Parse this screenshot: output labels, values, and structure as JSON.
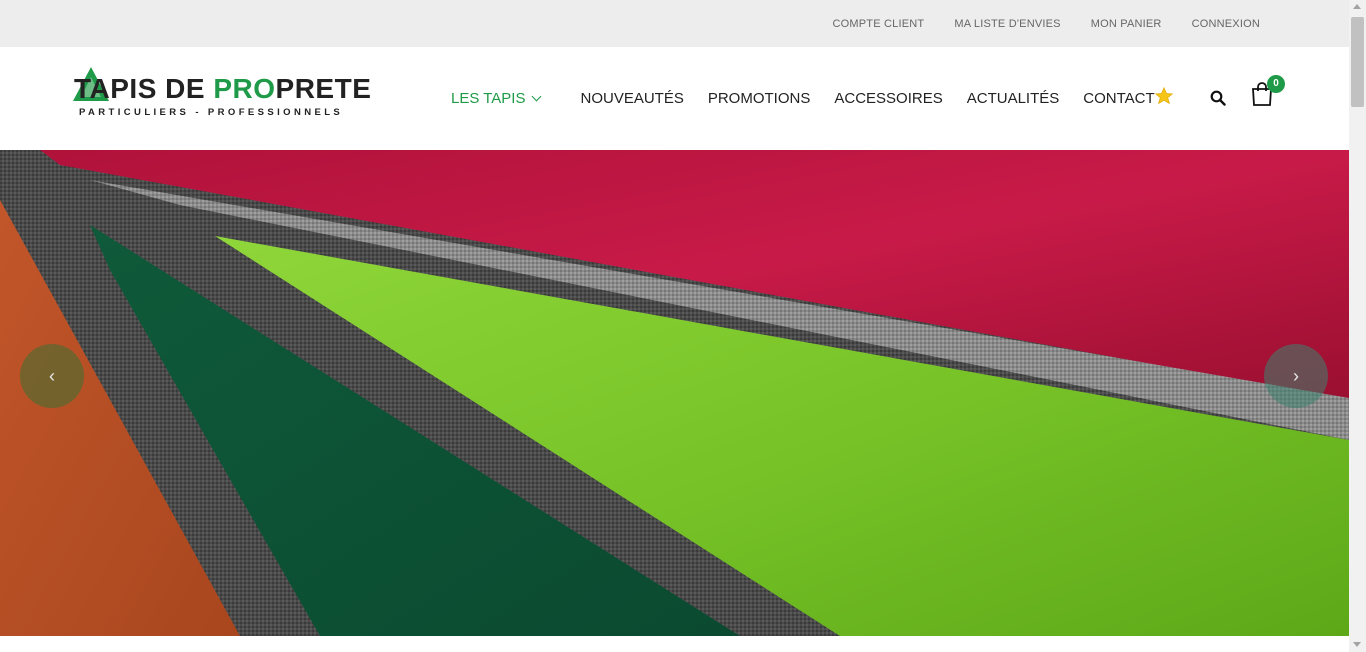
{
  "topbar": {
    "links": [
      "COMPTE CLIENT",
      "MA LISTE D'ENVIES",
      "MON PANIER",
      "CONNEXION"
    ]
  },
  "logo": {
    "title_a": "T",
    "title_b": "APIS DE ",
    "title_accent": "PRO",
    "title_c": "PRETE",
    "subtitle": "PARTICULIERS - PROFESSIONNELS"
  },
  "nav": {
    "items": [
      "LES TAPIS",
      "NOUVEAUTÉS",
      "PROMOTIONS",
      "ACCESSOIRES",
      "ACTUALITÉS",
      "CONTACT"
    ]
  },
  "icons": {
    "favorites": "star-icon",
    "search": "search-icon",
    "cart": "shopping-bag-icon"
  },
  "cart": {
    "count": "0"
  },
  "slider": {
    "prev_glyph": "‹",
    "next_glyph": "›"
  },
  "colors": {
    "accent": "#1f9a48",
    "topbar": "#ededed",
    "star": "#f5c518"
  }
}
